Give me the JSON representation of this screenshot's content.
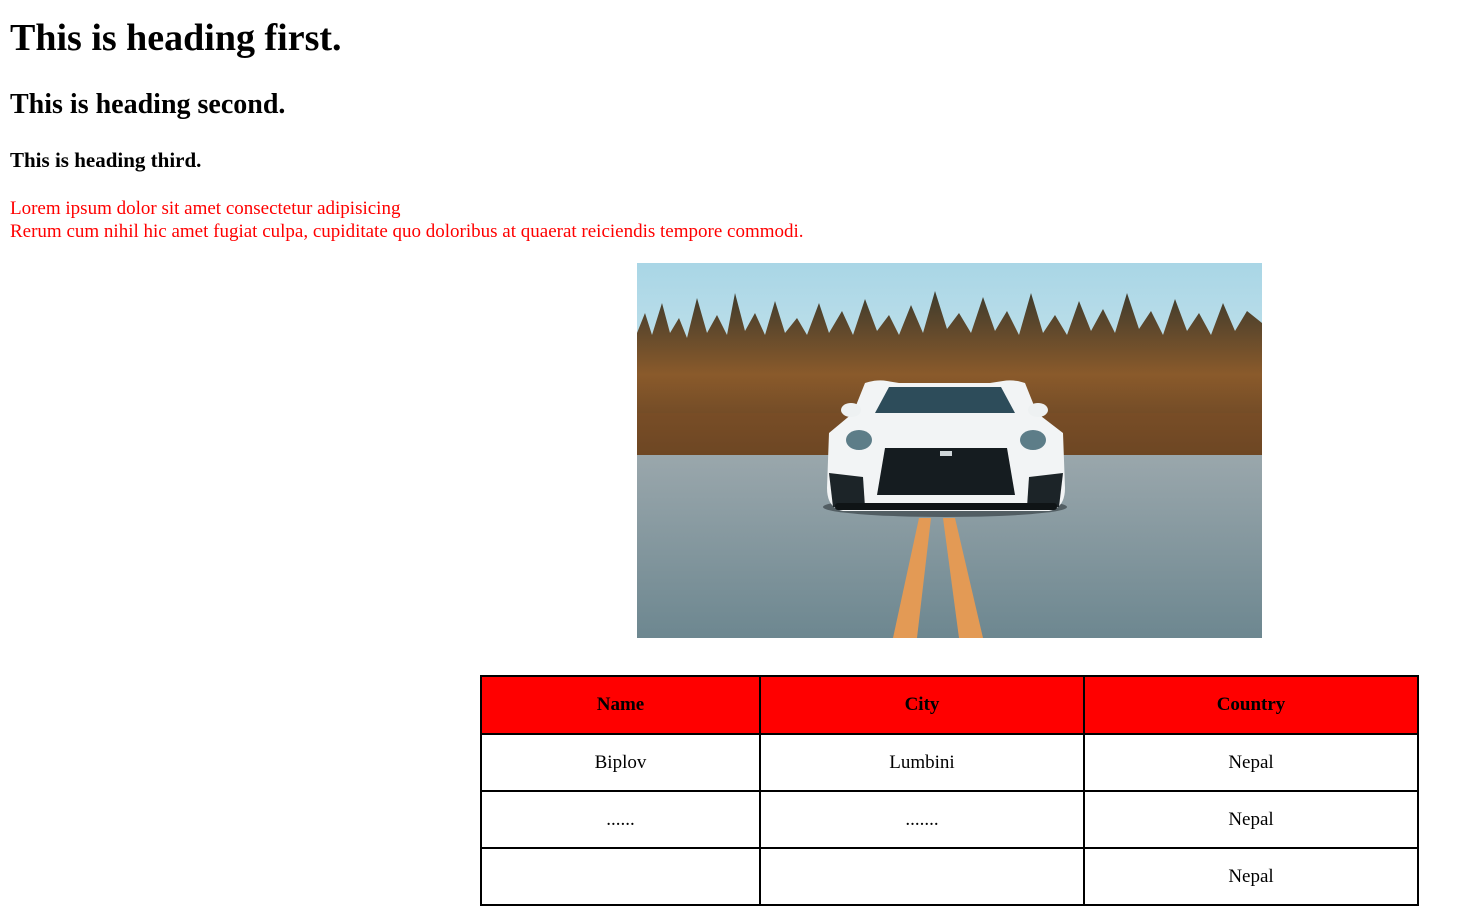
{
  "headings": {
    "h1": "This is heading first.",
    "h2": "This is heading second.",
    "h3": "This is heading third."
  },
  "paragraph": {
    "line1": "Lorem ipsum dolor sit amet consectetur adipisicing",
    "line2": "Rerum cum nihil hic amet fugiat culpa, cupiditate quo doloribus at quaerat reiciendis tempore commodi."
  },
  "image": {
    "description": "",
    "sky_color": "#b9dbe6",
    "road_color": "#7f8f97",
    "trees_color": "#8a5a2b",
    "car_color": "#f2f4f5",
    "lane_color": "#e39a55"
  },
  "table": {
    "header_bg": "#ff0000",
    "headers": [
      "Name",
      "City",
      "Country"
    ],
    "rows": [
      [
        "Biplov",
        "Lumbini",
        "Nepal"
      ],
      [
        "......",
        ".......",
        "Nepal"
      ],
      [
        "",
        "",
        "Nepal"
      ]
    ]
  }
}
